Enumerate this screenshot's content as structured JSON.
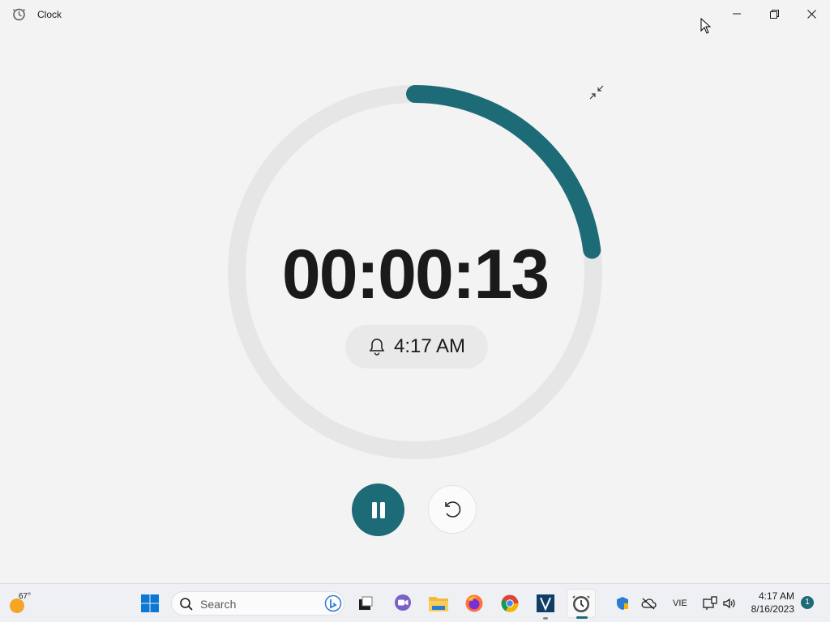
{
  "window": {
    "title": "Clock"
  },
  "timer": {
    "display": "00:00:13",
    "alarm_time": "4:17 AM",
    "progress": 0.23
  },
  "colors": {
    "accent": "#1e6b78",
    "track": "#e6e6e6"
  },
  "taskbar": {
    "weather_temp": "67°",
    "search_placeholder": "Search",
    "language": "VIE",
    "time": "4:17 AM",
    "date": "8/16/2023",
    "notifications": "1",
    "apps": [
      "start-icon",
      "search-icon",
      "bing-icon",
      "task-view-icon",
      "teams-chat-icon",
      "file-explorer-icon",
      "firefox-icon",
      "chrome-icon",
      "vscode-icon",
      "clock-icon"
    ],
    "tray_icons": [
      "defender-icon",
      "onedrive-icon",
      "network-icon",
      "volume-icon"
    ]
  }
}
